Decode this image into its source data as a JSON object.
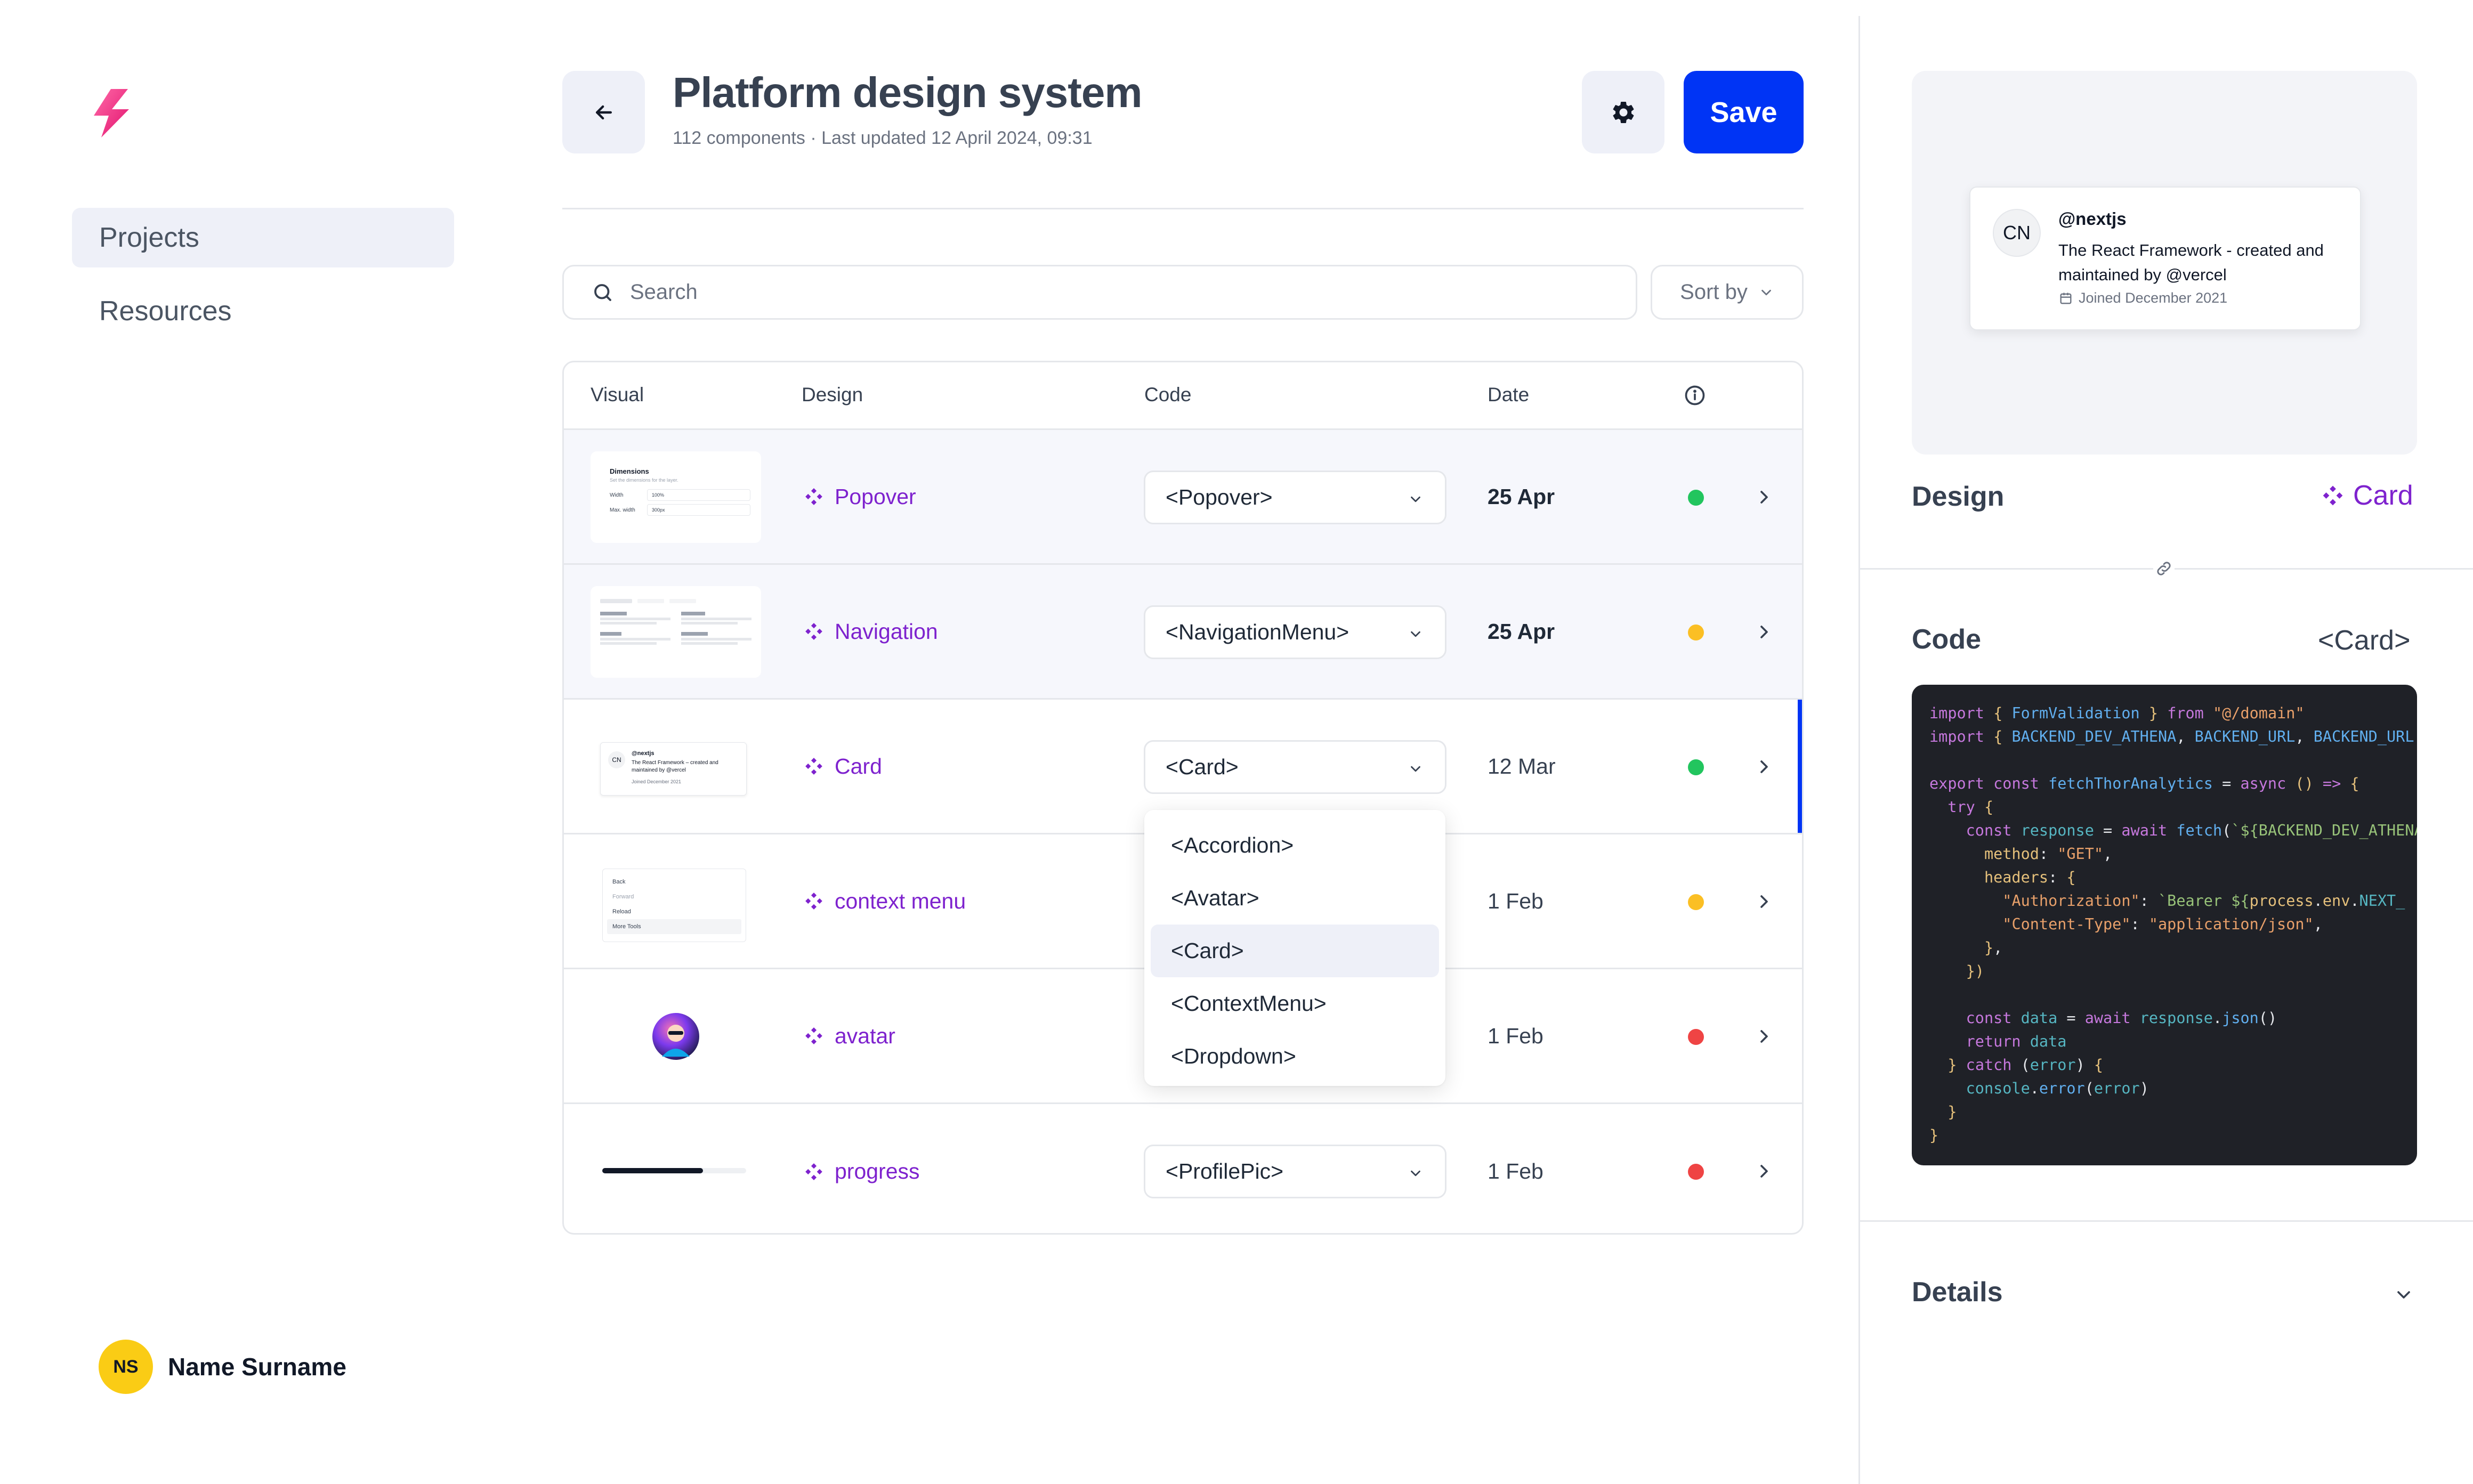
{
  "sidebar": {
    "nav": [
      {
        "label": "Projects",
        "active": true
      },
      {
        "label": "Resources",
        "active": false
      }
    ],
    "user": {
      "initials": "NS",
      "name": "Name Surname"
    }
  },
  "header": {
    "title": "Platform design system",
    "subtitle": "112 components · Last updated 12 April 2024, 09:31",
    "save_label": "Save"
  },
  "search": {
    "placeholder": "Search"
  },
  "sort": {
    "label": "Sort by"
  },
  "table": {
    "columns": [
      "Visual",
      "Design",
      "Code",
      "Date"
    ],
    "rows": [
      {
        "design": "Popover",
        "code": "<Popover>",
        "date": "25 Apr",
        "status": "#22c55e"
      },
      {
        "design": "Navigation",
        "code": "<NavigationMenu>",
        "date": "25 Apr",
        "status": "#fbbf24"
      },
      {
        "design": "Card",
        "code": "<Card>",
        "date": "12 Mar",
        "status": "#22c55e"
      },
      {
        "design": "context menu",
        "date": "1 Feb",
        "status": "#fbbf24"
      },
      {
        "design": "avatar",
        "date": "1 Feb",
        "status": "#ef4444"
      },
      {
        "design": "progress",
        "code": "<ProfilePic>",
        "date": "1 Feb",
        "status": "#ef4444"
      }
    ]
  },
  "thumbs": {
    "popover": {
      "title": "Dimensions",
      "sub": "Set the dimensions for the layer.",
      "r1": "Width",
      "v1": "100%",
      "r2": "Max. width",
      "v2": "300px"
    },
    "card": {
      "initials": "CN",
      "handle": "@nextjs",
      "desc": "The React Framework – created and maintained by @vercel",
      "joined": "Joined December 2021"
    },
    "menu": {
      "items": [
        "Back",
        "Forward",
        "Reload",
        "More Tools"
      ]
    }
  },
  "dropdown": {
    "options": [
      "<Accordion>",
      "<Avatar>",
      "<Card>",
      "<ContextMenu>",
      "<Dropdown>"
    ],
    "selected": "<Card>"
  },
  "right_panel": {
    "preview_card": {
      "initials": "CN",
      "handle": "@nextjs",
      "description": "The React Framework - created and maintained by @vercel",
      "joined": "Joined December 2021"
    },
    "design_label": "Design",
    "design_value": "Card",
    "code_label": "Code",
    "code_value": "<Card>",
    "details_label": "Details"
  },
  "colors": {
    "accent": "#0034f5",
    "purple": "#7e22ce"
  }
}
